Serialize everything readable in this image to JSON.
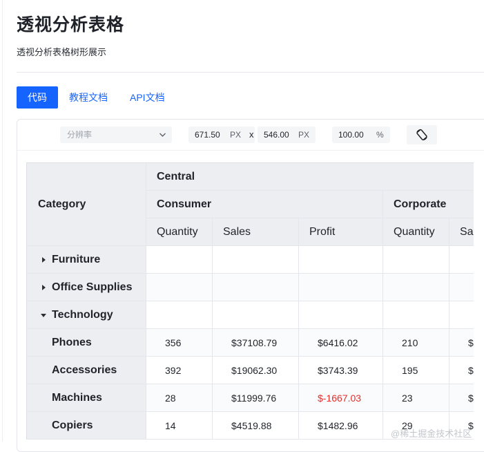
{
  "page": {
    "title": "透视分析表格",
    "subtitle": "透视分析表格树形展示"
  },
  "tabs": [
    {
      "label": "代码",
      "active": true
    },
    {
      "label": "教程文档",
      "active": false
    },
    {
      "label": "API文档",
      "active": false
    }
  ],
  "toolbar": {
    "resolution_placeholder": "分辨率",
    "width_value": "671.50",
    "width_unit": "PX",
    "times_sign": "x",
    "height_value": "546.00",
    "height_unit": "PX",
    "zoom_value": "100.00",
    "zoom_unit": "%",
    "rotate_icon": "rotate-screen-icon"
  },
  "pivot": {
    "corner_label": "Category",
    "region": "Central",
    "segments": [
      "Consumer",
      "Corporate"
    ],
    "measures": [
      "Quantity",
      "Sales",
      "Profit",
      "Quantity",
      "Sa"
    ],
    "rows": [
      {
        "label": "Furniture",
        "level": 0,
        "toggle": "collapsed",
        "values": [
          "",
          "",
          "",
          "",
          ""
        ]
      },
      {
        "label": "Office Supplies",
        "level": 0,
        "toggle": "collapsed",
        "values": [
          "",
          "",
          "",
          "",
          ""
        ]
      },
      {
        "label": "Technology",
        "level": 0,
        "toggle": "expanded",
        "values": [
          "",
          "",
          "",
          "",
          ""
        ]
      },
      {
        "label": "Phones",
        "level": 1,
        "toggle": "none",
        "values": [
          "356",
          "$37108.79",
          "$6416.02",
          "210",
          "$"
        ]
      },
      {
        "label": "Accessories",
        "level": 1,
        "toggle": "none",
        "values": [
          "392",
          "$19062.30",
          "$3743.39",
          "195",
          "$"
        ]
      },
      {
        "label": "Machines",
        "level": 1,
        "toggle": "none",
        "values": [
          "28",
          "$11999.76",
          "$-1667.03",
          "23",
          "$"
        ]
      },
      {
        "label": "Copiers",
        "level": 1,
        "toggle": "none",
        "values": [
          "14",
          "$4519.88",
          "$1482.96",
          "29",
          "$"
        ]
      }
    ],
    "negative_color": "#e62b2b"
  },
  "watermark": "@稀土掘金技术社区",
  "scroll_glyph": "⋮",
  "colors": {
    "accent": "#1664ff",
    "header_bg": "#eceef1"
  }
}
